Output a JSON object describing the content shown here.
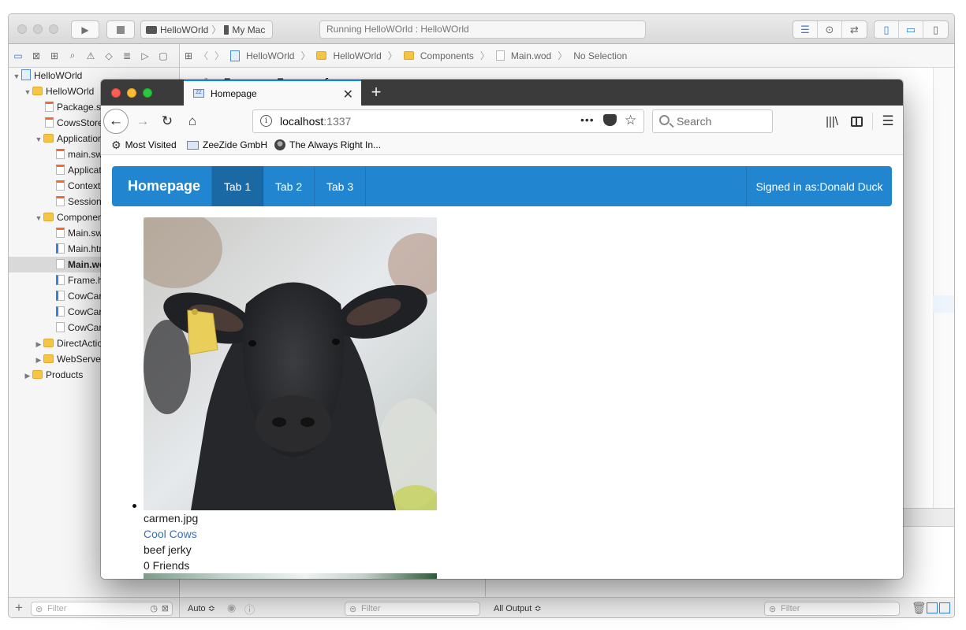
{
  "xcode": {
    "scheme": {
      "project": "HelloWOrld",
      "target": "My Mac"
    },
    "activity": "Running HelloWOrld : HelloWOrld",
    "jumpbar": [
      "HelloWOrld",
      "HelloWOrld",
      "Components",
      "Main.wod",
      "No Selection"
    ],
    "code_line_number": "1",
    "code_line_text": "Frame: Frame {",
    "tree": [
      {
        "label": "HelloWOrld",
        "kind": "proj"
      },
      {
        "label": "HelloWOrld",
        "kind": "folder"
      },
      {
        "label": "Package.swift",
        "kind": "swift"
      },
      {
        "label": "CowsStore.swift",
        "kind": "swift"
      },
      {
        "label": "Application",
        "kind": "folder"
      },
      {
        "label": "main.swift",
        "kind": "swift"
      },
      {
        "label": "Application.swift",
        "kind": "swift"
      },
      {
        "label": "Context.swift",
        "kind": "swift"
      },
      {
        "label": "Session.swift",
        "kind": "swift"
      },
      {
        "label": "Components",
        "kind": "folder"
      },
      {
        "label": "Main.swift",
        "kind": "swift"
      },
      {
        "label": "Main.html",
        "kind": "html"
      },
      {
        "label": "Main.wod",
        "kind": "file"
      },
      {
        "label": "Frame.html",
        "kind": "html"
      },
      {
        "label": "CowCard.swift",
        "kind": "html"
      },
      {
        "label": "CowCard.html",
        "kind": "html"
      },
      {
        "label": "CowCard.wod",
        "kind": "file"
      },
      {
        "label": "DirectAction",
        "kind": "folder"
      },
      {
        "label": "WebServer",
        "kind": "folder"
      },
      {
        "label": "Products",
        "kind": "folder"
      }
    ],
    "sidebar_filter_placeholder": "Filter",
    "debug_auto": "Auto ≎",
    "debug_filter_placeholder": "Filter",
    "output_selector": "All Output ≎",
    "output_filter_placeholder": "Filter"
  },
  "firefox": {
    "tab_title": "Homepage",
    "url_host": "localhost",
    "url_port": ":1337",
    "search_placeholder": "Search",
    "bookmarks": [
      "Most Visited",
      "ZeeZide GmbH",
      "The Always Right In..."
    ]
  },
  "page": {
    "brand": "Homepage",
    "tabs": [
      "Tab 1",
      "Tab 2",
      "Tab 3"
    ],
    "signed_in": "Signed in as:Donald Duck",
    "cow": {
      "filename": "carmen.jpg",
      "link": "Cool Cows",
      "favorite": "beef jerky",
      "friends": "0 Friends"
    }
  },
  "colors": {
    "menu_blue": "#2185d0",
    "menu_active": "#1a69a4",
    "link": "#3a70ab",
    "tab_accent": "#0a84ff"
  }
}
